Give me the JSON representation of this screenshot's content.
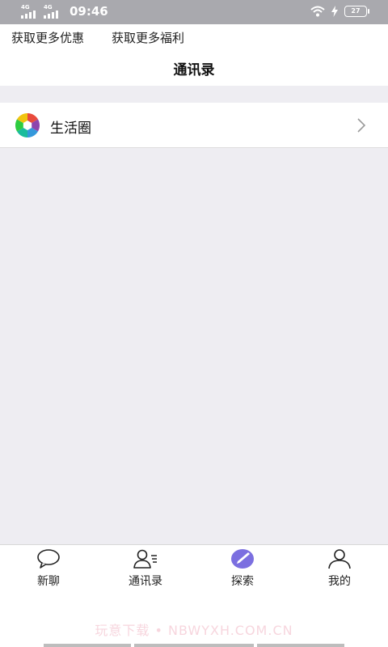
{
  "status": {
    "network1": "4G",
    "network2": "4G",
    "time": "09:46",
    "battery": "27"
  },
  "promo": {
    "more_offers": "获取更多优惠",
    "more_benefits": "获取更多福利"
  },
  "page": {
    "title": "通讯录"
  },
  "list": {
    "items": [
      {
        "label": "生活圈",
        "icon": "camera-aperture-icon"
      }
    ]
  },
  "tabs": [
    {
      "label": "新聊",
      "icon": "chat-bubble-icon"
    },
    {
      "label": "通讯录",
      "icon": "contacts-icon"
    },
    {
      "label": "探索",
      "icon": "compass-icon",
      "active": true
    },
    {
      "label": "我的",
      "icon": "person-icon"
    }
  ],
  "watermark": "玩意下载 • NBWYXH.COM.CN",
  "colors": {
    "accent": "#7b6fe0",
    "background": "#eeedf2"
  }
}
